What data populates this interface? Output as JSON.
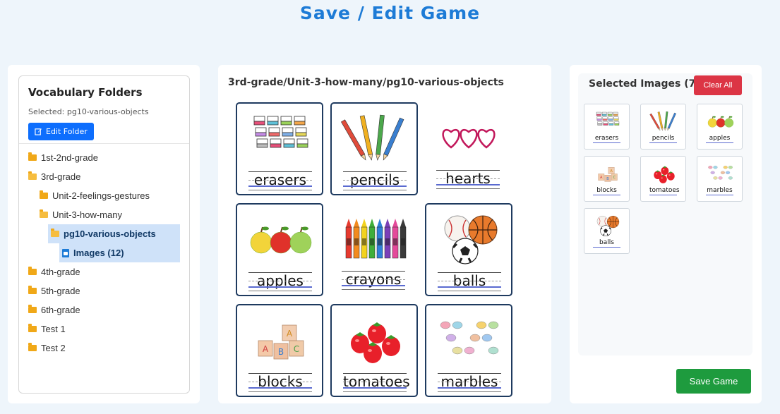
{
  "page": {
    "title": "Save / Edit Game"
  },
  "vocab": {
    "title": "Vocabulary Folders",
    "selected": "Selected: pg10-various-objects",
    "edit_label": "Edit Folder",
    "tree": [
      {
        "label": "1st-2nd-grade",
        "depth": 0,
        "icon": "folder-icon"
      },
      {
        "label": "3rd-grade",
        "depth": 0,
        "icon": "folder-open-icon"
      },
      {
        "label": "Unit-2-feelings-gestures",
        "depth": 1,
        "icon": "folder-icon"
      },
      {
        "label": "Unit-3-how-many",
        "depth": 1,
        "icon": "folder-open-icon"
      },
      {
        "label": "pg10-various-objects",
        "depth": 2,
        "icon": "folder-open-icon",
        "selected": true
      },
      {
        "label": "Images (12)",
        "depth": 3,
        "icon": "image-file-icon",
        "selected": true
      },
      {
        "label": "4th-grade",
        "depth": 0,
        "icon": "folder-icon"
      },
      {
        "label": "5th-grade",
        "depth": 0,
        "icon": "folder-icon"
      },
      {
        "label": "6th-grade",
        "depth": 0,
        "icon": "folder-icon"
      },
      {
        "label": "Test 1",
        "depth": 0,
        "icon": "folder-icon"
      },
      {
        "label": "Test 2",
        "depth": 0,
        "icon": "folder-icon"
      }
    ]
  },
  "gallery": {
    "path": "3rd-grade/Unit-3-how-many/pg10-various-objects",
    "cards": [
      {
        "word": "erasers",
        "selected": true
      },
      {
        "word": "pencils",
        "selected": true
      },
      {
        "word": "hearts",
        "selected": false
      },
      {
        "word": "apples",
        "selected": true
      },
      {
        "word": "crayons",
        "selected": false
      },
      {
        "word": "balls",
        "selected": true
      },
      {
        "word": "blocks",
        "selected": true
      },
      {
        "word": "tomatoes",
        "selected": true
      },
      {
        "word": "marbles",
        "selected": true
      }
    ]
  },
  "selected_panel": {
    "title": "Selected Images (7)",
    "clear_label": "Clear All",
    "save_label": "Save Game",
    "thumbs": [
      {
        "word": "erasers"
      },
      {
        "word": "pencils"
      },
      {
        "word": "apples"
      },
      {
        "word": "blocks"
      },
      {
        "word": "tomatoes"
      },
      {
        "word": "marbles"
      },
      {
        "word": "balls"
      }
    ]
  }
}
